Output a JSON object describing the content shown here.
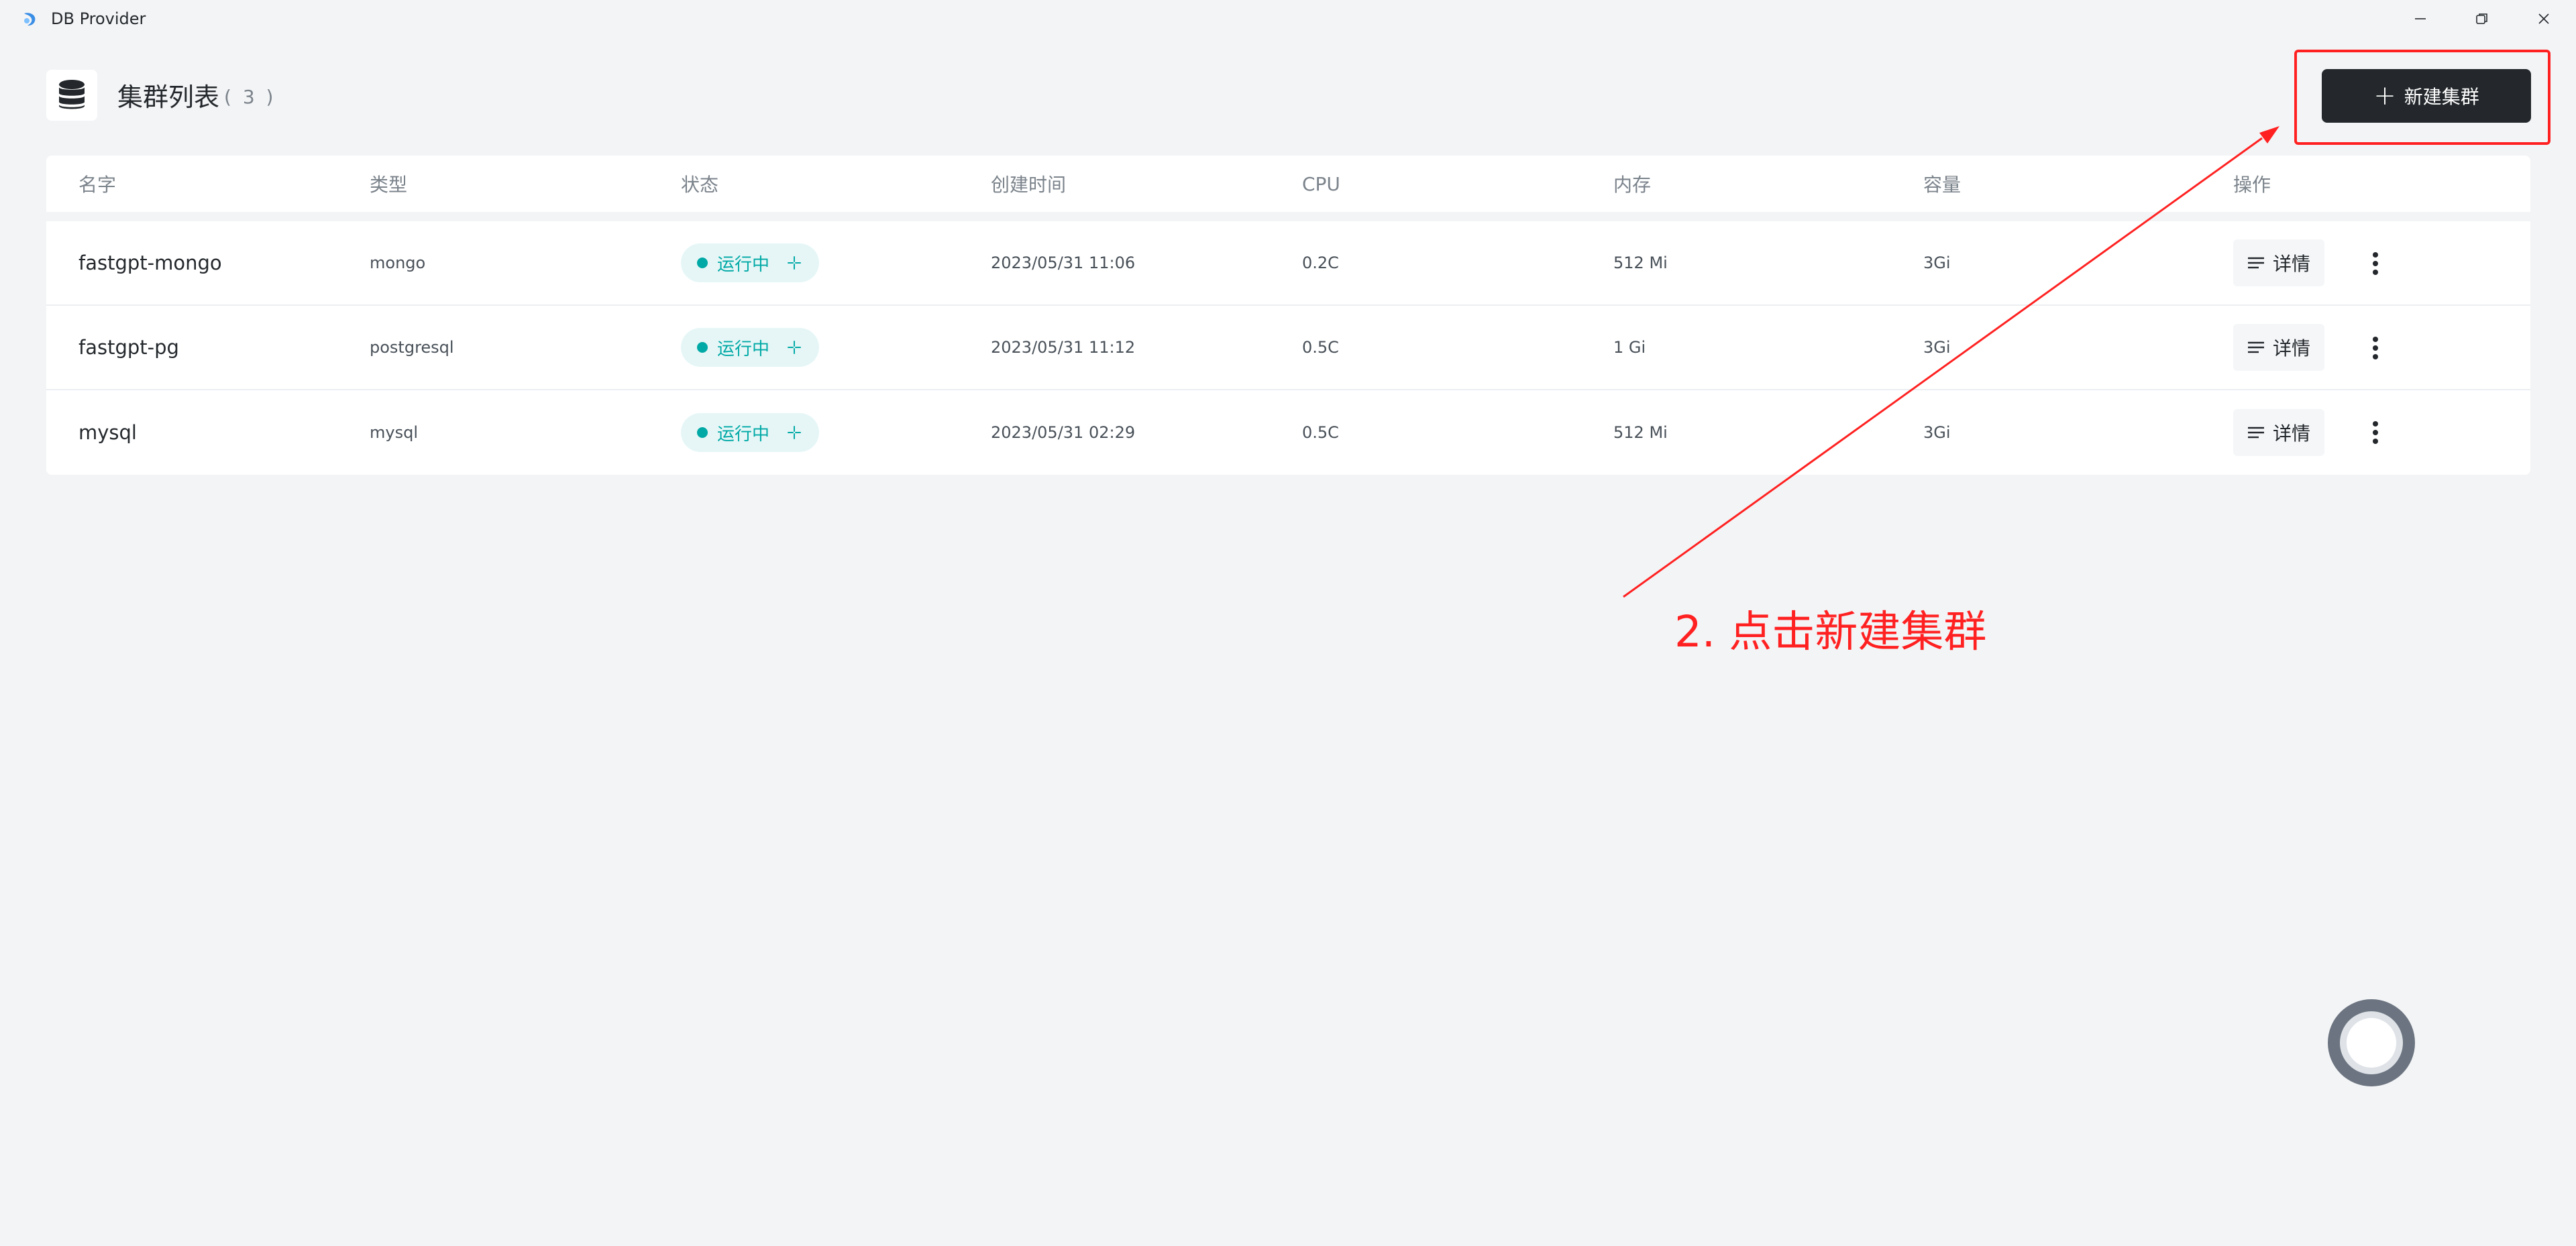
{
  "window": {
    "title": "DB Provider"
  },
  "header": {
    "title": "集群列表",
    "count": "( 3 )",
    "new_button_label": "新建集群"
  },
  "table": {
    "columns": [
      "名字",
      "类型",
      "状态",
      "创建时间",
      "CPU",
      "内存",
      "容量",
      "操作"
    ],
    "rows": [
      {
        "name": "fastgpt-mongo",
        "type": "mongo",
        "status": "运行中",
        "created": "2023/05/31 11:06",
        "cpu": "0.2C",
        "memory": "512 Mi",
        "storage": "3Gi",
        "detail_label": "详情"
      },
      {
        "name": "fastgpt-pg",
        "type": "postgresql",
        "status": "运行中",
        "created": "2023/05/31 11:12",
        "cpu": "0.5C",
        "memory": "1 Gi",
        "storage": "3Gi",
        "detail_label": "详情"
      },
      {
        "name": "mysql",
        "type": "mysql",
        "status": "运行中",
        "created": "2023/05/31 02:29",
        "cpu": "0.5C",
        "memory": "512 Mi",
        "storage": "3Gi",
        "detail_label": "详情"
      }
    ]
  },
  "annotation": {
    "text": "2. 点击新建集群"
  },
  "colors": {
    "accent_dark": "#24282c",
    "status_teal": "#00a9a6",
    "annotation_red": "#ff2121",
    "background": "#f3f4f6"
  },
  "icons": {
    "app": "app-logo-icon",
    "database": "database-icon",
    "plus": "plus-icon",
    "status": "sparkle-icon",
    "detail": "list-lines-icon",
    "more": "more-vertical-icon",
    "minimize": "minimize-icon",
    "restore": "restore-icon",
    "close": "close-icon"
  }
}
